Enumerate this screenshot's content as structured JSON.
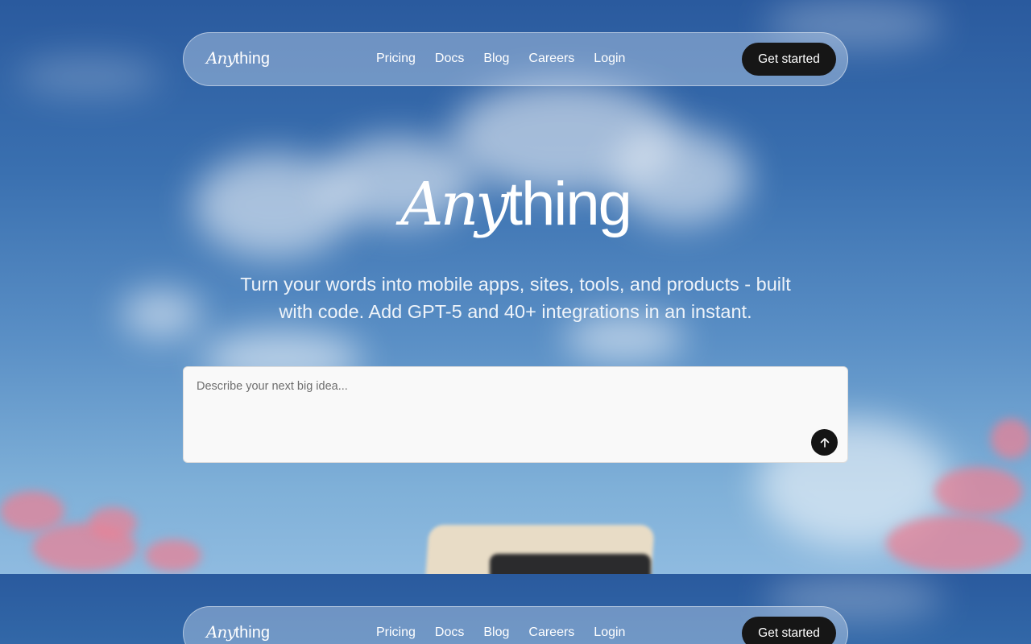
{
  "brand": {
    "any": "Any",
    "thing": "thing"
  },
  "nav": {
    "links": [
      "Pricing",
      "Docs",
      "Blog",
      "Careers",
      "Login"
    ],
    "cta": "Get started"
  },
  "hero": {
    "tagline_line1": "Turn your words into mobile apps, sites, tools, and products - built",
    "tagline_line2": "with code. Add GPT-5 and 40+ integrations in an instant."
  },
  "prompt": {
    "placeholder": "Describe your next big idea...",
    "submit_icon": "arrow-up-icon"
  },
  "colors": {
    "cta_bg": "#161616",
    "sky_top": "#2a5a9e",
    "sky_bottom": "#8fbbe0"
  }
}
